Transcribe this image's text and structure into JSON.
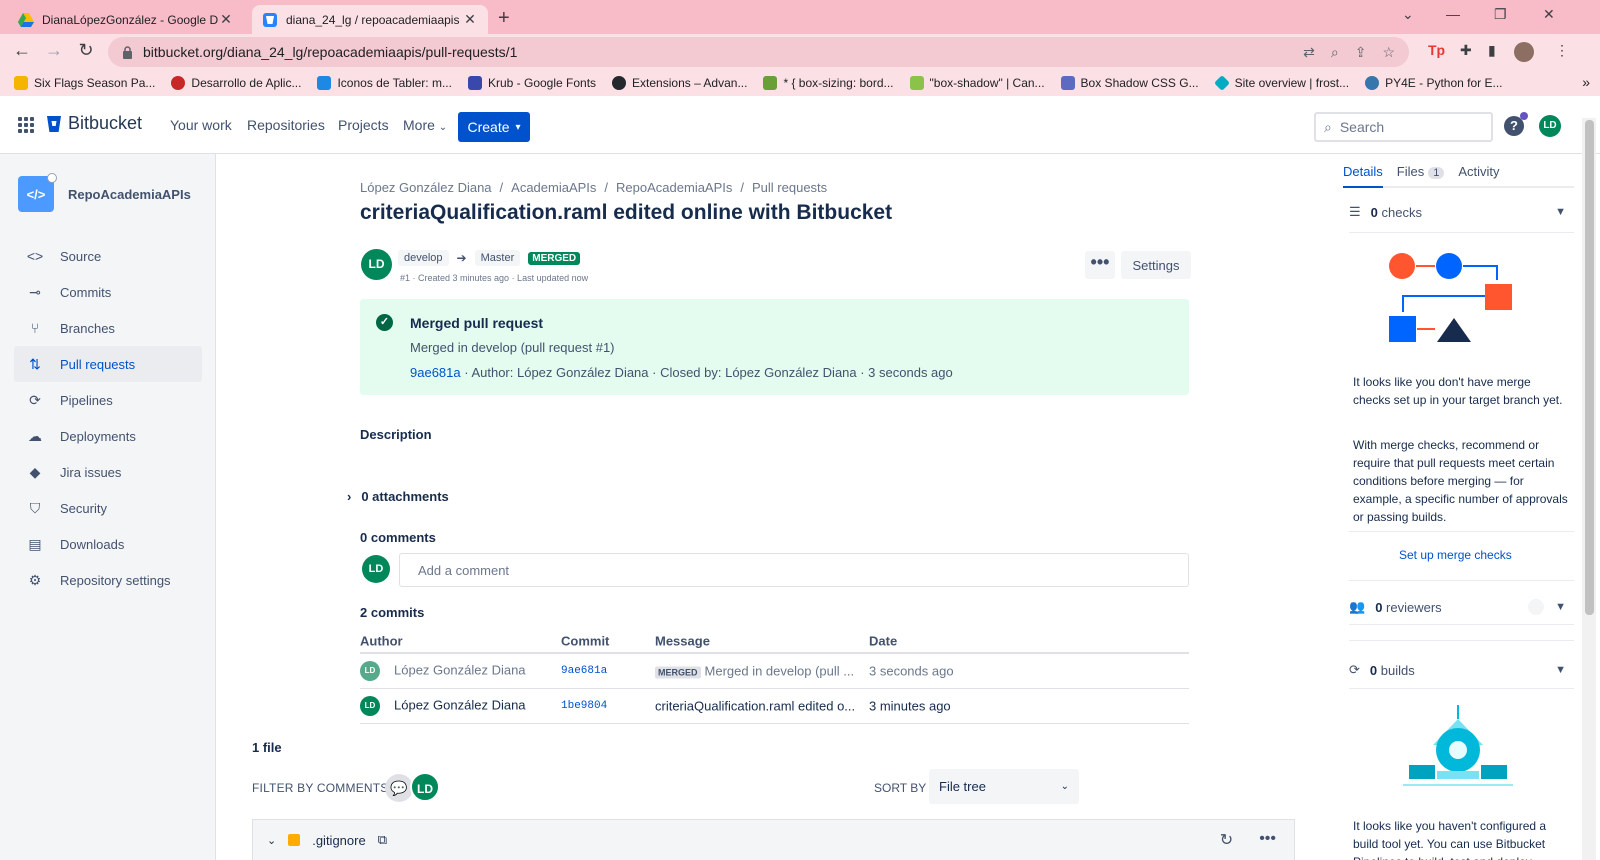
{
  "browser": {
    "tabs": [
      {
        "title": "DianaLópezGonzález - Google Dr",
        "close": "✕"
      },
      {
        "title": "diana_24_lg / repoacademiaapis",
        "close": "✕"
      }
    ],
    "new_tab": "+",
    "url": "bitbucket.org/diana_24_lg/repoacademiaapis/pull-requests/1",
    "bookmarks": [
      {
        "label": "Six Flags Season Pa...",
        "color": "#f4b400"
      },
      {
        "label": "Desarrollo de Aplic...",
        "color": "#c62828"
      },
      {
        "label": "Iconos de Tabler: m...",
        "color": "#1e88e5"
      },
      {
        "label": "Krub - Google Fonts",
        "color": "#3949ab"
      },
      {
        "label": "Extensions – Advan...",
        "color": "#24292e"
      },
      {
        "label": "* { box-sizing: bord...",
        "color": "#689f38"
      },
      {
        "label": "\"box-shadow\" | Can...",
        "color": "#8bc34a"
      },
      {
        "label": "Box Shadow CSS G...",
        "color": "#5c6bc0"
      },
      {
        "label": "Site overview | frost...",
        "color": "#00acc1"
      },
      {
        "label": "PY4E - Python for E...",
        "color": "#3776ab"
      }
    ]
  },
  "topnav": {
    "brand": "Bitbucket",
    "links": [
      "Your work",
      "Repositories",
      "Projects",
      "More"
    ],
    "create": "Create",
    "search_placeholder": "Search",
    "help": "?",
    "user_initials": "LD"
  },
  "sidebar": {
    "repo_name": "RepoAcademiaAPIs",
    "repo_icon": "</>",
    "items": [
      {
        "label": "Source",
        "icon": "code-icon",
        "glyph": "<>"
      },
      {
        "label": "Commits",
        "icon": "commit-icon",
        "glyph": "⊸"
      },
      {
        "label": "Branches",
        "icon": "branch-icon",
        "glyph": "⑂"
      },
      {
        "label": "Pull requests",
        "icon": "pull-request-icon",
        "glyph": "⇅"
      },
      {
        "label": "Pipelines",
        "icon": "pipelines-icon",
        "glyph": "⟳"
      },
      {
        "label": "Deployments",
        "icon": "deployments-icon",
        "glyph": "☁"
      },
      {
        "label": "Jira issues",
        "icon": "jira-icon",
        "glyph": "◆"
      },
      {
        "label": "Security",
        "icon": "shield-icon",
        "glyph": "⛉"
      },
      {
        "label": "Downloads",
        "icon": "file-icon",
        "glyph": "▤"
      },
      {
        "label": "Repository settings",
        "icon": "gear-icon",
        "glyph": "⚙"
      }
    ],
    "selected_index": 3
  },
  "main": {
    "breadcrumbs": [
      "López González Diana",
      "/",
      "AcademiaAPIs",
      "/",
      "RepoAcademiaAPIs",
      "/",
      "Pull requests"
    ],
    "title": "criteriaQualification.raml edited online with Bitbucket",
    "author_initials": "LD",
    "source_branch": "develop",
    "target_branch": "Master",
    "status": "MERGED",
    "meta": "#1 · Created 3 minutes ago · Last updated now",
    "more": "•••",
    "settings": "Settings",
    "merged_box": {
      "title": "Merged pull request",
      "subtitle": "Merged in develop (pull request #1)",
      "hash": "9ae681a",
      "details": " · Author: López González Diana · Closed by: López González Diana · 3 seconds ago"
    },
    "description_label": "Description",
    "attachments_label": "0 attachments",
    "comments_label": "0 comments",
    "comment_placeholder": "Add a comment",
    "commits_label": "2 commits",
    "commit_headers": [
      "Author",
      "Commit",
      "Message",
      "Date"
    ],
    "commits": [
      {
        "initials": "LD",
        "author": "López González Diana",
        "hash": "9ae681a",
        "lozenge": "MERGED",
        "message": "Merged in develop (pull ...",
        "date": "3 seconds ago"
      },
      {
        "initials": "LD",
        "author": "López González Diana",
        "hash": "1be9804",
        "message": "criteriaQualification.raml edited o...",
        "date": "3 minutes ago"
      }
    ],
    "files_label": "1 file",
    "filter_label": "FILTER BY COMMENTS",
    "sort_label": "SORT BY",
    "sort_value": "File tree",
    "file_name": ".gitignore"
  },
  "right_panel": {
    "tabs": [
      {
        "label": "Details"
      },
      {
        "label": "Files",
        "badge": "1"
      },
      {
        "label": "Activity"
      }
    ],
    "checks": {
      "count": "0",
      "label": "checks"
    },
    "checks_text_1": "It looks like you don't have merge checks set up in your target branch yet.",
    "checks_text_2": "With merge checks, recommend or require that pull requests meet certain conditions before merging — for example, a specific number of approvals or passing builds.",
    "checks_link": "Set up merge checks",
    "reviewers": {
      "count": "0",
      "label": "reviewers"
    },
    "builds": {
      "count": "0",
      "label": "builds"
    },
    "builds_text": "It looks like you haven't configured a build tool yet. You can use Bitbucket Pipelines to build, test and deploy"
  }
}
